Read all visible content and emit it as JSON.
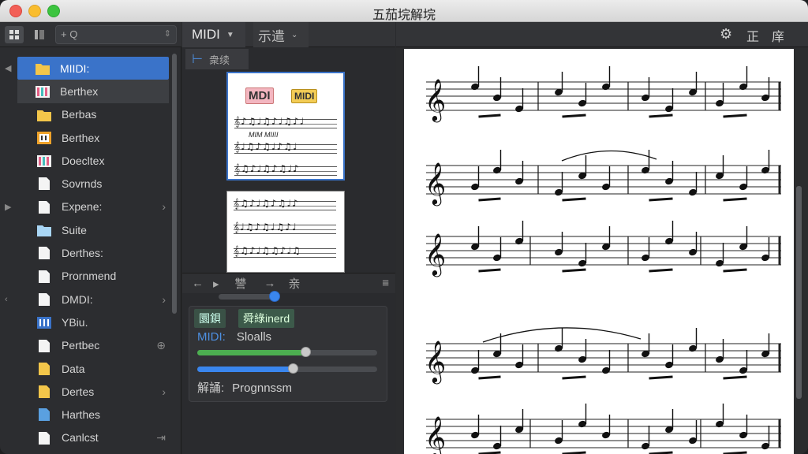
{
  "window": {
    "title": "五茄垸解垸"
  },
  "sidebar": {
    "search_placeholder": "+ Q",
    "items": [
      {
        "label": "MIIDI:",
        "icon": "folder-icon",
        "color": "#f3c64a"
      },
      {
        "label": "Berthex",
        "icon": "midi-file-icon",
        "color": "#e45f86"
      },
      {
        "label": "Berbas",
        "icon": "folder-icon",
        "color": "#f3c64a"
      },
      {
        "label": "Berthex",
        "icon": "music-file-icon",
        "color": "#f0a32a"
      },
      {
        "label": "Doecltex",
        "icon": "midi-file-icon",
        "color": "#e45f86"
      },
      {
        "label": "Sovrnds",
        "icon": "document-icon",
        "color": "#f4f4f4"
      },
      {
        "label": "Expene:",
        "icon": "document-icon",
        "color": "#f4f4f4"
      },
      {
        "label": "Suite",
        "icon": "folder-icon",
        "color": "#a9d6f5"
      },
      {
        "label": "Derthes:",
        "icon": "document-icon",
        "color": "#f4f4f4"
      },
      {
        "label": "Prornmend",
        "icon": "document-icon",
        "color": "#f4f4f4"
      },
      {
        "label": "DMDI:",
        "icon": "document-icon",
        "color": "#f4f4f4"
      },
      {
        "label": "YBiu.",
        "icon": "midi-file-icon",
        "color": "#3a73c9"
      },
      {
        "label": "Pertbec",
        "icon": "document-icon",
        "color": "#f4f4f4"
      },
      {
        "label": "Data",
        "icon": "folder-icon",
        "color": "#f3c64a"
      },
      {
        "label": "Dertes",
        "icon": "document-icon",
        "color": "#f3c64a"
      },
      {
        "label": "Harthes",
        "icon": "document-icon",
        "color": "#5aa0e0"
      },
      {
        "label": "Canlcst",
        "icon": "document-icon",
        "color": "#f4f4f4"
      }
    ]
  },
  "middle": {
    "tab_midi": "MIDI",
    "tab_view": "示遣",
    "subtab": "衆续",
    "thumb1": {
      "tag1": "MDI",
      "tag2": "MIDI",
      "caption": "MIM MIIII"
    },
    "navbar": {
      "back": "←",
      "fwd": "▸",
      "mid": "讐",
      "arrow": "→",
      "tail": "亲"
    },
    "panel": {
      "btn1": "圜鋇",
      "btn2": "舜綠inerd",
      "row1_key": "MIDI:",
      "row1_val": "Sloalls",
      "row2_key": "解誦:",
      "row2_val": "Prognnssm",
      "bar1": 0.6,
      "bar2": 0.53,
      "bar1_color": "#4caf50",
      "bar2_color": "#3a86ee"
    }
  },
  "score_toolbar": {
    "gear": "⚙",
    "t1": "正",
    "t2": "庠"
  }
}
